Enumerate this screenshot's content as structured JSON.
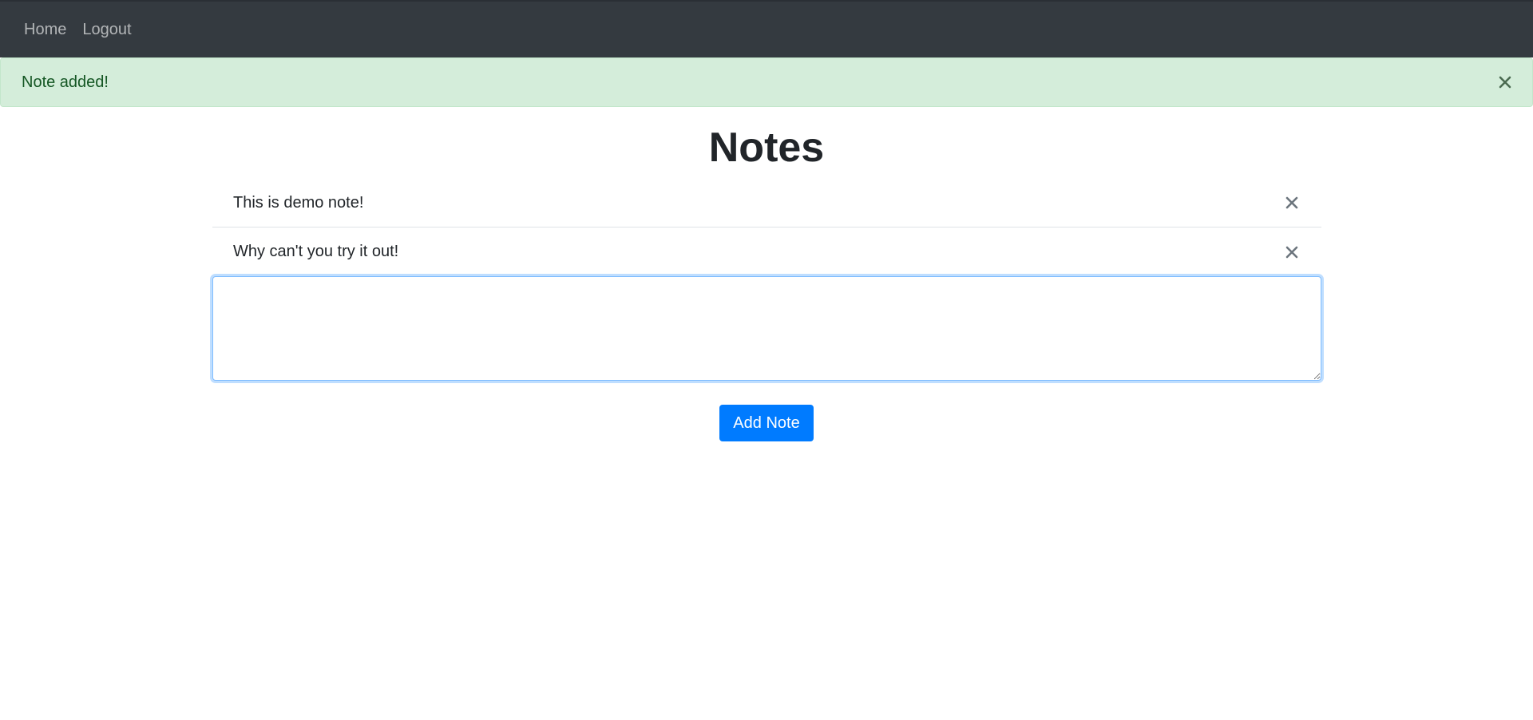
{
  "nav": {
    "items": [
      {
        "label": "Home"
      },
      {
        "label": "Logout"
      }
    ]
  },
  "alert": {
    "message": "Note added!",
    "close_icon": "close-icon"
  },
  "page": {
    "title": "Notes"
  },
  "notes": [
    {
      "text": "This is demo note!",
      "delete_icon": "close-icon"
    },
    {
      "text": "Why can't you try it out!",
      "delete_icon": "close-icon"
    }
  ],
  "input": {
    "value": "",
    "placeholder": ""
  },
  "actions": {
    "add_label": "Add Note"
  },
  "colors": {
    "navbar": "#343a40",
    "alert_bg": "#d4edda",
    "alert_text": "#155724",
    "primary": "#007bff"
  }
}
